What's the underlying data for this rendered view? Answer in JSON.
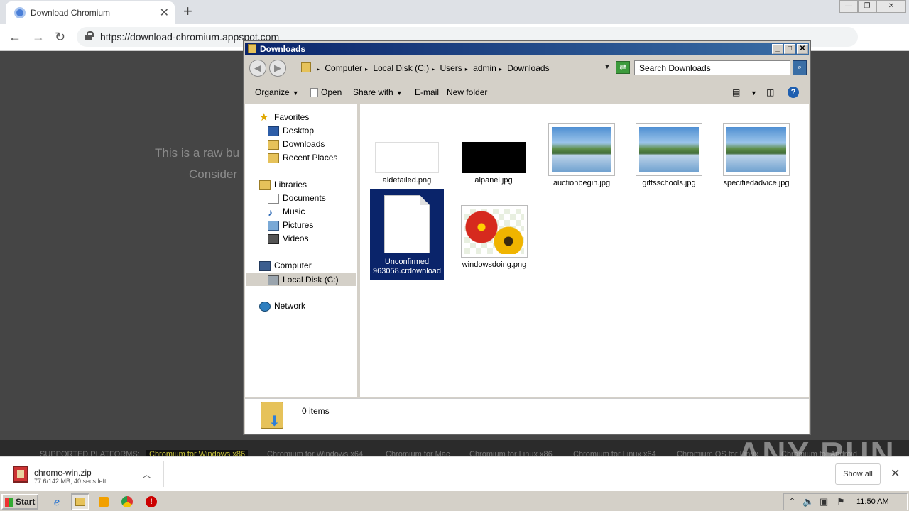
{
  "browser": {
    "tab_title": "Download Chromium",
    "url": "https://download-chromium.appspot.com",
    "bg_line1": "This is a raw bu",
    "bg_line2": "Consider"
  },
  "platforms": {
    "label": "SUPPORTED PLATFORMS:",
    "links": [
      "Chromium for Windows x86",
      "Chromium for Windows x64",
      "Chromium for Mac",
      "Chromium for Linux x86",
      "Chromium for Linux x64",
      "Chromium OS for Linux",
      "Chromium for Android"
    ]
  },
  "watermark": "ANY RUN",
  "download": {
    "filename": "chrome-win.zip",
    "status": "77.6/142 MB, 40 secs left",
    "show_all": "Show all"
  },
  "explorer": {
    "title": "Downloads",
    "breadcrumbs": [
      "Computer",
      "Local Disk (C:)",
      "Users",
      "admin",
      "Downloads"
    ],
    "search_placeholder": "Search Downloads",
    "toolbar": {
      "organize": "Organize",
      "open": "Open",
      "share_with": "Share with",
      "email": "E-mail",
      "new_folder": "New folder"
    },
    "nav": {
      "favorites": "Favorites",
      "desktop": "Desktop",
      "downloads": "Downloads",
      "recent_places": "Recent Places",
      "libraries": "Libraries",
      "documents": "Documents",
      "music": "Music",
      "pictures": "Pictures",
      "videos": "Videos",
      "computer": "Computer",
      "local_disk": "Local Disk (C:)",
      "network": "Network"
    },
    "files": [
      {
        "name": "aldetailed.png"
      },
      {
        "name": "alpanel.jpg"
      },
      {
        "name": "auctionbegin.jpg"
      },
      {
        "name": "giftsschools.jpg"
      },
      {
        "name": "specifiedadvice.jpg"
      },
      {
        "name_line1": "Unconfirmed",
        "name_line2": "963058.crdownload"
      },
      {
        "name": "windowsdoing.png"
      }
    ],
    "status": "0 items"
  },
  "taskbar": {
    "start": "Start",
    "clock": "11:50 AM"
  }
}
